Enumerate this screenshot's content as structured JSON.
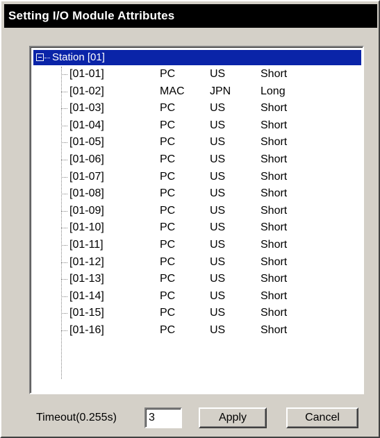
{
  "window": {
    "title": "Setting I/O Module Attributes"
  },
  "tree": {
    "root_label": "Station [01]",
    "rows": [
      {
        "id": "[01-01]",
        "platform": "PC",
        "region": "US",
        "length": "Short"
      },
      {
        "id": "[01-02]",
        "platform": "MAC",
        "region": "JPN",
        "length": "Long"
      },
      {
        "id": "[01-03]",
        "platform": "PC",
        "region": "US",
        "length": "Short"
      },
      {
        "id": "[01-04]",
        "platform": "PC",
        "region": "US",
        "length": "Short"
      },
      {
        "id": "[01-05]",
        "platform": "PC",
        "region": "US",
        "length": "Short"
      },
      {
        "id": "[01-06]",
        "platform": "PC",
        "region": "US",
        "length": "Short"
      },
      {
        "id": "[01-07]",
        "platform": "PC",
        "region": "US",
        "length": "Short"
      },
      {
        "id": "[01-08]",
        "platform": "PC",
        "region": "US",
        "length": "Short"
      },
      {
        "id": "[01-09]",
        "platform": "PC",
        "region": "US",
        "length": "Short"
      },
      {
        "id": "[01-10]",
        "platform": "PC",
        "region": "US",
        "length": "Short"
      },
      {
        "id": "[01-11]",
        "platform": "PC",
        "region": "US",
        "length": "Short"
      },
      {
        "id": "[01-12]",
        "platform": "PC",
        "region": "US",
        "length": "Short"
      },
      {
        "id": "[01-13]",
        "platform": "PC",
        "region": "US",
        "length": "Short"
      },
      {
        "id": "[01-14]",
        "platform": "PC",
        "region": "US",
        "length": "Short"
      },
      {
        "id": "[01-15]",
        "platform": "PC",
        "region": "US",
        "length": "Short"
      },
      {
        "id": "[01-16]",
        "platform": "PC",
        "region": "US",
        "length": "Short"
      }
    ]
  },
  "footer": {
    "timeout_label": "Timeout(0.255s)",
    "timeout_value": "3",
    "apply_label": "Apply",
    "cancel_label": "Cancel"
  },
  "colors": {
    "title_bg": "#000000",
    "selection_bg": "#0a24a8",
    "dialog_bg": "#d4d0c8"
  }
}
